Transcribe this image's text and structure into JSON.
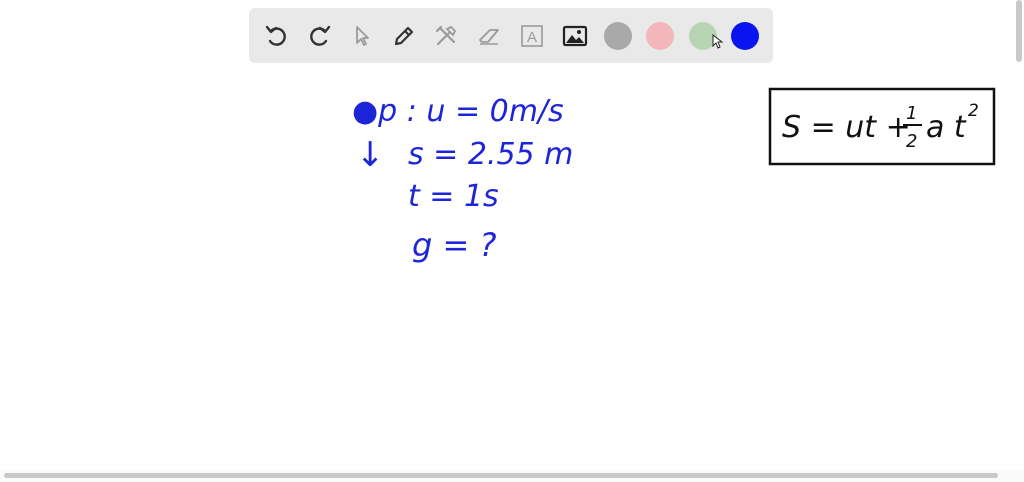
{
  "toolbar": {
    "tools": [
      {
        "name": "undo-button",
        "icon": "undo-icon"
      },
      {
        "name": "redo-button",
        "icon": "redo-icon"
      },
      {
        "name": "select-button",
        "icon": "pointer-icon"
      },
      {
        "name": "pen-button",
        "icon": "pen-icon"
      },
      {
        "name": "tools-button",
        "icon": "tools-icon"
      },
      {
        "name": "eraser-button",
        "icon": "eraser-icon"
      },
      {
        "name": "text-button",
        "icon": "text-icon"
      },
      {
        "name": "image-button",
        "icon": "image-icon"
      }
    ],
    "text_tool_letter": "A",
    "colors": [
      {
        "name": "gray",
        "hex": "#a9a9a9"
      },
      {
        "name": "pink",
        "hex": "#f2b6bb"
      },
      {
        "name": "green",
        "hex": "#b7d5b2"
      },
      {
        "name": "blue",
        "hex": "#0a14f0",
        "selected": true
      }
    ]
  },
  "board": {
    "ink_color": "#1d25d8",
    "formula_color": "#111111",
    "given": {
      "line1": "●p : u = 0m/s",
      "arrow": "↓",
      "line2": "s = 2.55 m",
      "line3": "t = 1s",
      "line4": "g = ?"
    },
    "formula": {
      "left": "S = ut +",
      "num": "1",
      "den": "2",
      "right": "a t",
      "exp": "2"
    }
  }
}
